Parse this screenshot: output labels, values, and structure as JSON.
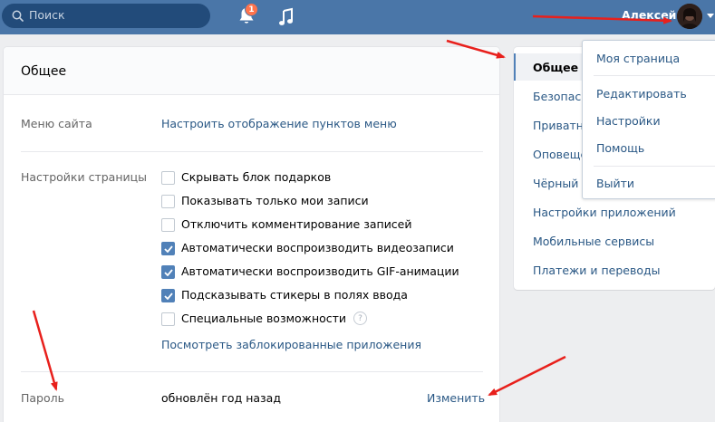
{
  "header": {
    "search_placeholder": "Поиск",
    "notification_count": "1",
    "user_name": "Алексей"
  },
  "settings": {
    "title": "Общее",
    "site_menu": {
      "label": "Меню сайта",
      "link": "Настроить отображение пунктов меню"
    },
    "page_settings": {
      "label": "Настройки страницы",
      "options": [
        {
          "text": "Скрывать блок подарков",
          "checked": false
        },
        {
          "text": "Показывать только мои записи",
          "checked": false
        },
        {
          "text": "Отключить комментирование записей",
          "checked": false
        },
        {
          "text": "Автоматически воспроизводить видеозаписи",
          "checked": true
        },
        {
          "text": "Автоматически воспроизводить GIF-анимации",
          "checked": true
        },
        {
          "text": "Подсказывать стикеры в полях ввода",
          "checked": true
        },
        {
          "text": "Специальные возможности",
          "checked": false
        }
      ],
      "help_symbol": "?",
      "blocked_apps_link": "Посмотреть заблокированные приложения"
    },
    "password": {
      "label": "Пароль",
      "value": "обновлён год назад",
      "change_link": "Изменить"
    }
  },
  "side_menu": {
    "items": [
      {
        "label": "Общее",
        "active": true
      },
      {
        "label": "Безопасн",
        "active": false
      },
      {
        "label": "Приватно",
        "active": false
      },
      {
        "label": "Оповеще",
        "active": false
      },
      {
        "label": "Чёрный с",
        "active": false
      },
      {
        "label": "Настройки приложений",
        "active": false
      },
      {
        "label": "Мобильные сервисы",
        "active": false
      },
      {
        "label": "Платежи и переводы",
        "active": false
      }
    ]
  },
  "dropdown": {
    "items": [
      "Моя страница",
      "Редактировать",
      "Настройки",
      "Помощь",
      "Выйти"
    ]
  },
  "colors": {
    "header_bg": "#4a76a8",
    "link": "#2a5885",
    "checkbox_checked": "#5181b8",
    "annotation_arrow": "#e8201c",
    "badge": "#ff734c"
  },
  "icons": [
    "search-icon",
    "bell-icon",
    "music-icon",
    "checkmark-icon",
    "chevron-down-icon",
    "help-icon",
    "arrow-annotation"
  ]
}
